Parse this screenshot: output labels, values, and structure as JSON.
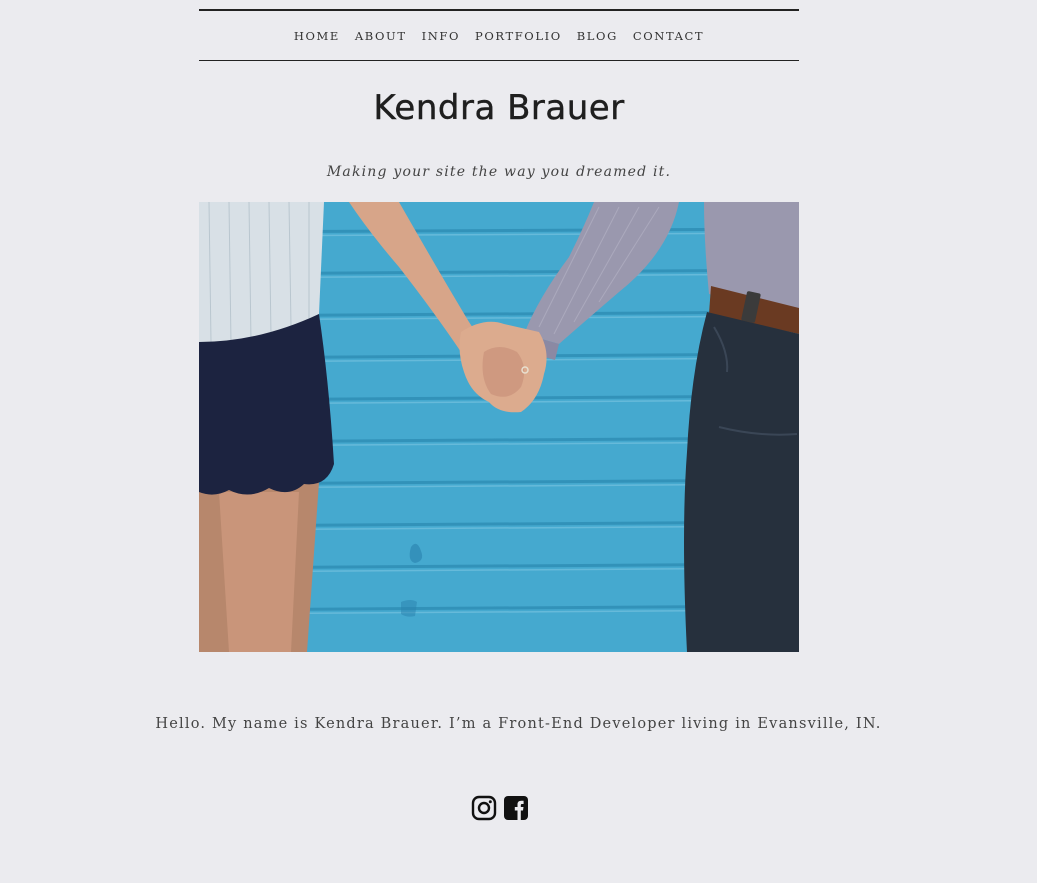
{
  "nav": {
    "items": [
      {
        "label": "HOME"
      },
      {
        "label": "ABOUT"
      },
      {
        "label": "INFO"
      },
      {
        "label": "PORTFOLIO"
      },
      {
        "label": "BLOG"
      },
      {
        "label": "CONTACT"
      }
    ]
  },
  "site": {
    "title": "Kendra Brauer",
    "tagline": "Making your site the way you dreamed it."
  },
  "hero": {
    "icon": "hero-photo-holding-hands",
    "colors": {
      "wall": "#45a9cf",
      "shorts": "#1c2340",
      "jeans": "#26303d",
      "skin": "#d9a98a"
    }
  },
  "intro": {
    "text": "Hello. My name is Kendra Brauer. I’m a Front-End Developer living in Evansville, IN."
  },
  "social": {
    "items": [
      {
        "icon": "instagram-icon"
      },
      {
        "icon": "facebook-icon"
      }
    ]
  }
}
